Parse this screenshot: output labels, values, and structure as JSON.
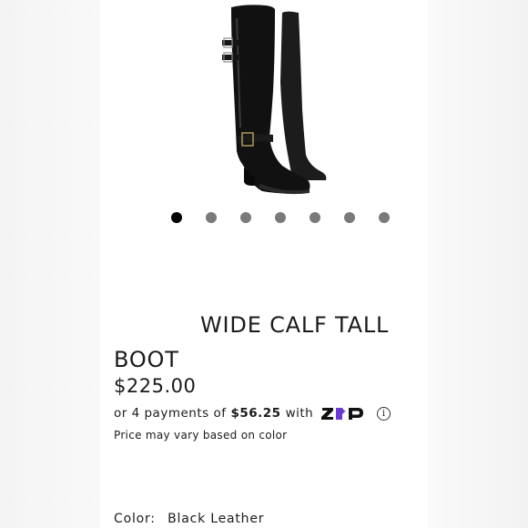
{
  "product": {
    "title": "WIDE CALF TALL BOOT",
    "price": "$225.00",
    "installments": {
      "prefix": "or 4 payments of",
      "amount": "$56.25",
      "suffix": "with",
      "provider_logo_text": "ZIP",
      "info_icon": "info-icon"
    },
    "price_note": "Price may vary based on color",
    "color": {
      "label": "Color:",
      "value": "Black Leather"
    }
  },
  "gallery": {
    "image_count": 7,
    "active_index": 0,
    "dot_colors": {
      "active": "#000000",
      "inactive": "#7a7a7a"
    }
  },
  "colors": {
    "zip_purple": "#6b3ad6",
    "text": "#1b1b1b",
    "background": "#ffffff"
  }
}
